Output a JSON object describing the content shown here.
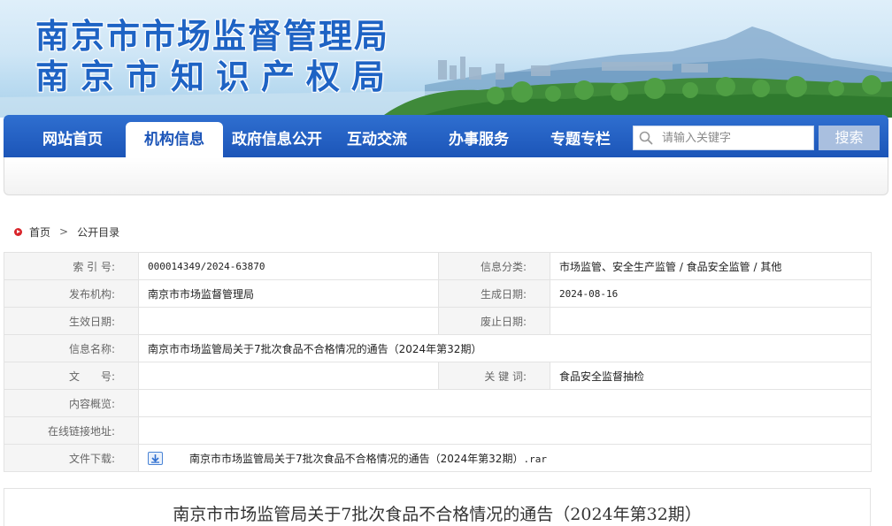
{
  "banner": {
    "title_line1": "南京市市场监督管理局",
    "title_line2": "南京市知识产权局"
  },
  "nav": {
    "items": [
      {
        "label": "网站首页",
        "active": false
      },
      {
        "label": "机构信息",
        "active": true
      },
      {
        "label": "政府信息公开",
        "active": false
      },
      {
        "label": "互动交流",
        "active": false
      },
      {
        "label": "办事服务",
        "active": false
      },
      {
        "label": "专题专栏",
        "active": false
      }
    ],
    "search_placeholder": "请输入关键字",
    "search_button": "搜索",
    "search_icon": "search-icon"
  },
  "breadcrumb": {
    "home": "首页",
    "current": "公开目录",
    "separator": ">"
  },
  "meta": {
    "index_label": "索 引 号:",
    "index_value": "000014349/2024-63870",
    "category_label": "信息分类:",
    "category_value": "市场监管、安全生产监管 / 食品安全监管 / 其他",
    "publisher_label": "发布机构:",
    "publisher_value": "南京市市场监督管理局",
    "created_label": "生成日期:",
    "created_value": "2024-08-16",
    "effective_label": "生效日期:",
    "effective_value": "",
    "repeal_label": "废止日期:",
    "repeal_value": "",
    "name_label": "信息名称:",
    "name_value": "南京市市场监管局关于7批次食品不合格情况的通告（2024年第32期）",
    "docno_label": "文　　号:",
    "docno_value": "",
    "keywords_label": "关 键 词:",
    "keywords_value": "食品安全监督抽检",
    "summary_label": "内容概览:",
    "summary_value": "",
    "link_label": "在线链接地址:",
    "link_value": "",
    "download_label": "文件下载:",
    "download_name": "南京市市场监管局关于7批次食品不合格情况的通告（2024年第32期）",
    "download_ext": ".rar"
  },
  "article": {
    "title": "南京市市场监管局关于7批次食品不合格情况的通告（2024年第32期）"
  },
  "colors": {
    "brand_blue": "#1c55b8",
    "title_blue": "#1e63c4",
    "search_button": "#a9bfdf",
    "home_dot": "#d9252b"
  }
}
